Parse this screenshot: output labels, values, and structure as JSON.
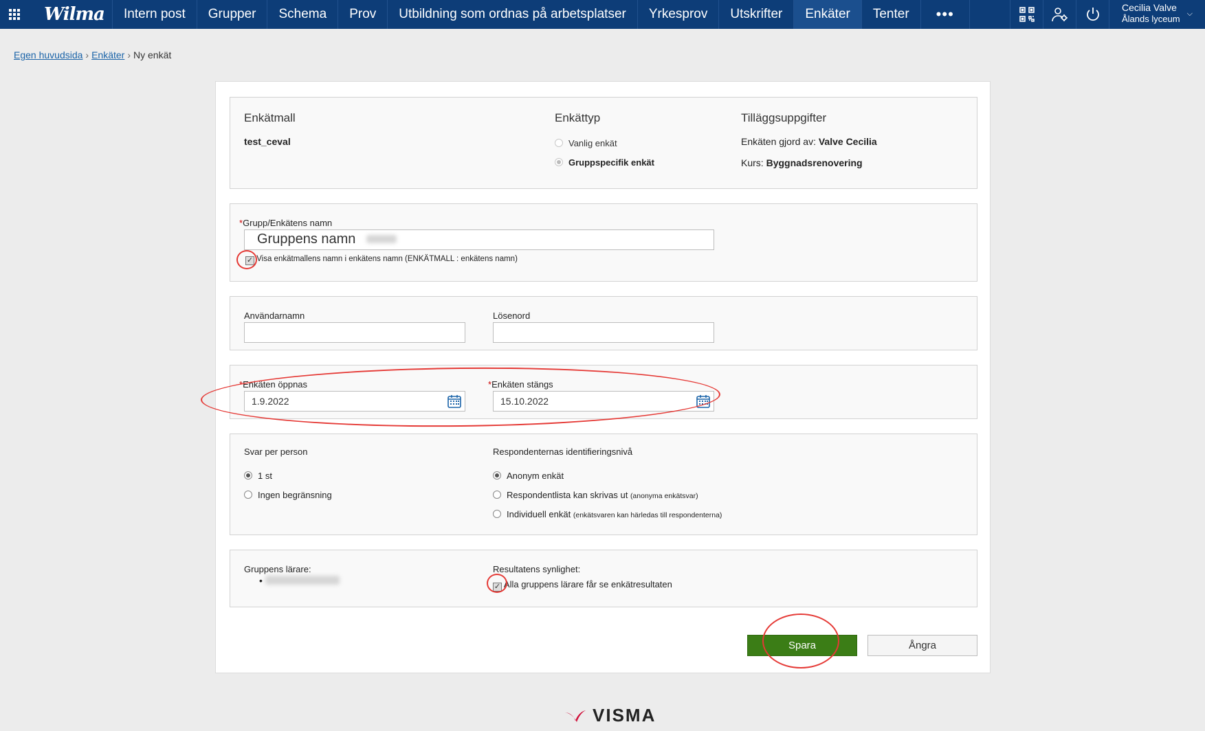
{
  "topbar": {
    "logo": "Wilma",
    "nav": [
      "Intern post",
      "Grupper",
      "Schema",
      "Prov",
      "Utbildning som ordnas på arbetsplatser",
      "Yrkesprov",
      "Utskrifter",
      "Enkäter",
      "Tenter"
    ],
    "active_nav": "Enkäter",
    "more": "•••",
    "user_name": "Cecilia Valve",
    "user_school": "Ålands lyceum"
  },
  "breadcrumb": {
    "home": "Egen huvudsida",
    "surveys": "Enkäter",
    "current": "Ny enkät",
    "separator": "›"
  },
  "template": {
    "heading": "Enkätmall",
    "value": "test_ceval"
  },
  "survey_type": {
    "heading": "Enkättyp",
    "options": [
      "Vanlig enkät",
      "Gruppspecifik enkät"
    ],
    "selected": "Gruppspecifik enkät"
  },
  "extra_info": {
    "heading": "Tilläggsuppgifter",
    "made_by_label": "Enkäten gjord av:",
    "made_by_value": "Valve Cecilia",
    "course_label": "Kurs:",
    "course_value": "Byggnadsrenovering"
  },
  "name_section": {
    "required_mark": "*",
    "label": "Grupp/Enkätens namn",
    "value": "Gruppens namn",
    "checkbox_label": "Visa enkätmallens namn i enkätens namn (ENKÄTMALL : enkätens namn)",
    "checkbox_checked": true
  },
  "credentials": {
    "username_label": "Användarnamn",
    "password_label": "Lösenord"
  },
  "dates": {
    "open_label": "Enkäten öppnas",
    "open_value": "1.9.2022",
    "close_label": "Enkäten stängs",
    "close_value": "15.10.2022"
  },
  "answers": {
    "heading": "Svar per person",
    "options": [
      "1 st",
      "Ingen begränsning"
    ],
    "selected": "1 st"
  },
  "identification": {
    "heading": "Respondenternas identifieringsnivå",
    "options": [
      {
        "label": "Anonym enkät",
        "note": ""
      },
      {
        "label": "Respondentlista kan skrivas ut",
        "note": "(anonyma enkätsvar)"
      },
      {
        "label": "Individuell enkät",
        "note": "(enkätsvaren kan härledas till respondenterna)"
      }
    ],
    "selected": "Anonym enkät"
  },
  "teachers": {
    "heading": "Gruppens lärare:"
  },
  "visibility": {
    "heading": "Resultatens synlighet:",
    "checkbox_label": "Alla gruppens lärare får se enkätresultaten",
    "checked": true
  },
  "buttons": {
    "save": "Spara",
    "undo": "Ångra"
  },
  "footer": {
    "brand": "VISMA"
  },
  "colors": {
    "nav_bg": "#0d3d78",
    "save_bg": "#3b7d16",
    "annotation": "#e53935",
    "link": "#1a63a8"
  }
}
